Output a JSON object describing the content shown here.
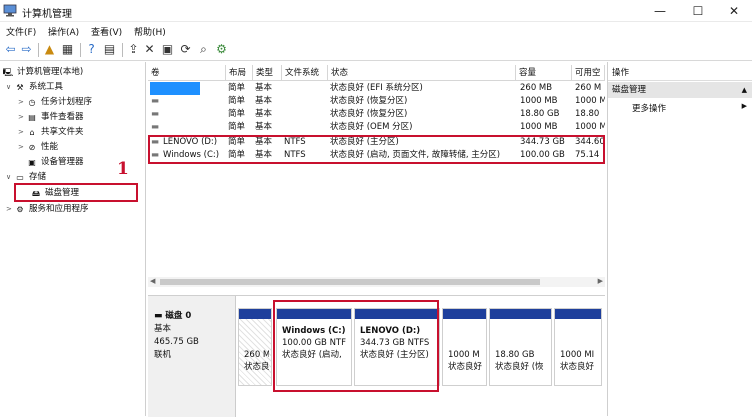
{
  "window": {
    "title": "计算机管理",
    "icon": "computer-management-icon",
    "minimize": "—",
    "maximize": "☐",
    "close": "✕"
  },
  "menu": [
    "文件(F)",
    "操作(A)",
    "查看(V)",
    "帮助(H)"
  ],
  "toolbar": [
    "back-arrow-icon",
    "forward-arrow-icon",
    "up-folder-icon",
    "show-hide-tree-icon",
    "help-icon",
    "console-icon",
    "export-icon",
    "delete-icon",
    "properties-icon",
    "refresh-icon",
    "search-icon",
    "settings-icon"
  ],
  "tree": {
    "root": "计算机管理(本地)",
    "system_tools": "系统工具",
    "task_scheduler": "任务计划程序",
    "event_viewer": "事件查看器",
    "shared_folders": "共享文件夹",
    "performance": "性能",
    "device_manager": "设备管理器",
    "storage": "存储",
    "disk_management": "磁盘管理",
    "services_apps": "服务和应用程序"
  },
  "volumes": {
    "headers": [
      "卷",
      "布局",
      "类型",
      "文件系统",
      "状态",
      "容量",
      "可用空"
    ],
    "rows": [
      {
        "vol": "",
        "layout": "简单",
        "type": "基本",
        "fs": "",
        "status": "状态良好 (EFI 系统分区)",
        "cap": "260 MB",
        "free": "260 M"
      },
      {
        "vol": "",
        "layout": "简单",
        "type": "基本",
        "fs": "",
        "status": "状态良好 (恢复分区)",
        "cap": "1000 MB",
        "free": "1000 M"
      },
      {
        "vol": "",
        "layout": "简单",
        "type": "基本",
        "fs": "",
        "status": "状态良好 (恢复分区)",
        "cap": "18.80 GB",
        "free": "18.80"
      },
      {
        "vol": "",
        "layout": "简单",
        "type": "基本",
        "fs": "",
        "status": "状态良好 (OEM 分区)",
        "cap": "1000 MB",
        "free": "1000 M"
      },
      {
        "vol": "LENOVO (D:)",
        "layout": "简单",
        "type": "基本",
        "fs": "NTFS",
        "status": "状态良好 (主分区)",
        "cap": "344.73 GB",
        "free": "344.60"
      },
      {
        "vol": "Windows (C:)",
        "layout": "简单",
        "type": "基本",
        "fs": "NTFS",
        "status": "状态良好 (启动, 页面文件, 故障转储, 主分区)",
        "cap": "100.00 GB",
        "free": "75.14"
      }
    ]
  },
  "disk": {
    "name": "磁盘 0",
    "type": "基本",
    "size": "465.75 GB",
    "state": "联机",
    "partitions": [
      {
        "name": "",
        "size": "260 M",
        "status": "状态良"
      },
      {
        "name": "Windows  (C:)",
        "size": "100.00 GB NTF",
        "status": "状态良好 (启动,"
      },
      {
        "name": "LENOVO  (D:)",
        "size": "344.73 GB NTFS",
        "status": "状态良好 (主分区)"
      },
      {
        "name": "",
        "size": "1000 M",
        "status": "状态良好"
      },
      {
        "name": "",
        "size": "18.80 GB",
        "status": "状态良好 (恢"
      },
      {
        "name": "",
        "size": "1000 MI",
        "status": "状态良好"
      }
    ]
  },
  "actions": {
    "header": "操作",
    "selected": "磁盘管理",
    "more": "更多操作"
  },
  "annotation": {
    "step": "1",
    "color": "#c8102e"
  },
  "colors": {
    "partition_bar": "#1e3f9c",
    "selection": "#e5e5e5",
    "redacted": "#1e90ff"
  }
}
